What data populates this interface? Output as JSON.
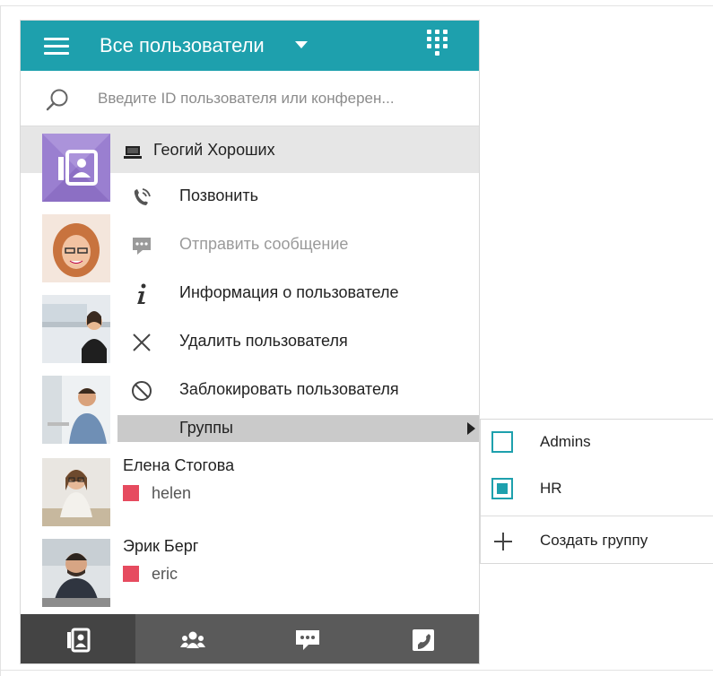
{
  "header": {
    "title": "Все пользователи",
    "accent_color": "#1ea0ad"
  },
  "search": {
    "placeholder": "Введите ID пользователя или конферен..."
  },
  "selected_user": {
    "name": "Геогий Хороших",
    "avatar_icon": "contact-card-icon",
    "device_icon": "laptop-icon"
  },
  "context_menu": {
    "items": [
      {
        "label": "Позвонить",
        "icon": "call-icon",
        "enabled": true
      },
      {
        "label": "Отправить сообщение",
        "icon": "message-icon",
        "enabled": false
      },
      {
        "label": "Информация о пользователе",
        "icon": "info-icon",
        "enabled": true
      },
      {
        "label": "Удалить пользователя",
        "icon": "close-icon",
        "enabled": true
      },
      {
        "label": "Заблокировать пользователя",
        "icon": "block-icon",
        "enabled": true
      },
      {
        "label": "Группы",
        "icon": "",
        "enabled": true,
        "has_submenu": true
      }
    ]
  },
  "groups_submenu": {
    "items": [
      {
        "label": "Admins",
        "checked": false
      },
      {
        "label": "HR",
        "checked": true
      }
    ],
    "create_label": "Создать группу"
  },
  "users": [
    {
      "name": "Елена Стогова",
      "login": "helen",
      "status_color": "#e64b5f"
    },
    {
      "name": "Эрик Берг",
      "login": "eric",
      "status_color": "#e64b5f"
    }
  ],
  "tabs": [
    {
      "name": "contacts",
      "icon": "contacts-icon",
      "active": true
    },
    {
      "name": "conferences",
      "icon": "group-icon",
      "active": false
    },
    {
      "name": "chats",
      "icon": "chat-icon",
      "active": false
    },
    {
      "name": "calls",
      "icon": "phone-icon",
      "active": false
    }
  ]
}
